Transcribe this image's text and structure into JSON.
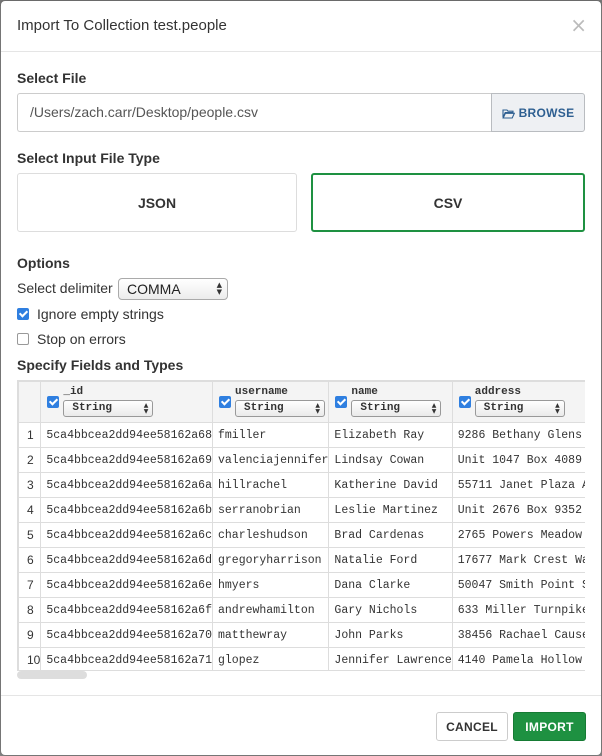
{
  "dialog": {
    "title": "Import To Collection test.people",
    "close_glyph": "×"
  },
  "file": {
    "section_label": "Select File",
    "path": "/Users/zach.carr/Desktop/people.csv",
    "browse_label": "BROWSE",
    "browse_icon": "folder-open-icon"
  },
  "file_type": {
    "section_label": "Select Input File Type",
    "options": [
      "JSON",
      "CSV"
    ],
    "selected": "CSV"
  },
  "options": {
    "section_label": "Options",
    "delimiter_label": "Select delimiter",
    "delimiter_value": "COMMA",
    "ignore_empty_label": "Ignore empty strings",
    "ignore_empty_checked": true,
    "stop_on_errors_label": "Stop on errors",
    "stop_on_errors_checked": false
  },
  "fields": {
    "section_label": "Specify Fields and Types",
    "columns": [
      {
        "name": "_id",
        "type": "String",
        "checked": true
      },
      {
        "name": "username",
        "type": "String",
        "checked": true
      },
      {
        "name": "name",
        "type": "String",
        "checked": true
      },
      {
        "name": "address",
        "type": "String",
        "checked": true
      }
    ],
    "rows": [
      {
        "n": "1",
        "cells": [
          "5ca4bbcea2dd94ee58162a68",
          "fmiller",
          "Elizabeth Ray",
          "9286 Bethany Glens"
        ]
      },
      {
        "n": "2",
        "cells": [
          "5ca4bbcea2dd94ee58162a69",
          "valenciajennifer",
          "Lindsay Cowan",
          "Unit 1047 Box 4089"
        ]
      },
      {
        "n": "3",
        "cells": [
          "5ca4bbcea2dd94ee58162a6a",
          "hillrachel",
          "Katherine David",
          "55711 Janet Plaza A"
        ]
      },
      {
        "n": "4",
        "cells": [
          "5ca4bbcea2dd94ee58162a6b",
          "serranobrian",
          "Leslie Martinez",
          "Unit 2676 Box 9352"
        ]
      },
      {
        "n": "5",
        "cells": [
          "5ca4bbcea2dd94ee58162a6c",
          "charleshudson",
          "Brad Cardenas",
          "2765 Powers Meadow"
        ]
      },
      {
        "n": "6",
        "cells": [
          "5ca4bbcea2dd94ee58162a6d",
          "gregoryharrison",
          "Natalie Ford",
          "17677 Mark Crest Wa"
        ]
      },
      {
        "n": "7",
        "cells": [
          "5ca4bbcea2dd94ee58162a6e",
          "hmyers",
          "Dana Clarke",
          "50047 Smith Point S"
        ]
      },
      {
        "n": "8",
        "cells": [
          "5ca4bbcea2dd94ee58162a6f",
          "andrewhamilton",
          "Gary Nichols",
          "633 Miller Turnpike"
        ]
      },
      {
        "n": "9",
        "cells": [
          "5ca4bbcea2dd94ee58162a70",
          "matthewray",
          "John Parks",
          "38456 Rachael Cause"
        ]
      },
      {
        "n": "10",
        "cells": [
          "5ca4bbcea2dd94ee58162a71",
          "glopez",
          "Jennifer Lawrence",
          "4140 Pamela Hollow"
        ]
      }
    ]
  },
  "footer": {
    "cancel_label": "CANCEL",
    "import_label": "IMPORT"
  },
  "colors": {
    "accent_green": "#1e9141",
    "checkbox_blue": "#2f7fe0",
    "browse_text": "#2e5f91"
  }
}
